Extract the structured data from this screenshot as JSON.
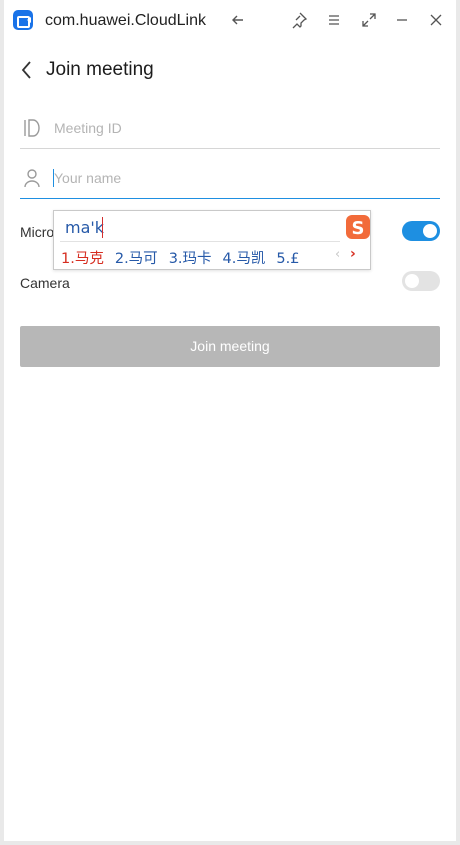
{
  "window": {
    "title": "com.huawei.CloudLink",
    "controls": [
      "back-arrow-icon",
      "pin-icon",
      "menu-icon",
      "expand-icon",
      "minimize-icon",
      "close-icon"
    ]
  },
  "header": {
    "title": "Join meeting"
  },
  "form": {
    "meeting_id_placeholder": "Meeting ID",
    "name_placeholder": "Your name",
    "microphone_label": "Micro",
    "microphone_on": true,
    "camera_label": "Camera",
    "camera_on": false,
    "join_label": "Join meeting"
  },
  "ime": {
    "composition": "ma'k",
    "candidates": [
      "1.马克",
      "2.马可",
      "3.玛卡",
      "4.马凯",
      "5.£"
    ],
    "prev_glyph": "‹",
    "next_glyph": "›",
    "logo": "S"
  },
  "colors": {
    "accent": "#1e8fe1",
    "disabled_button": "#b7b7b7",
    "ime_highlight": "#d62d20",
    "ime_text": "#2659a8"
  }
}
